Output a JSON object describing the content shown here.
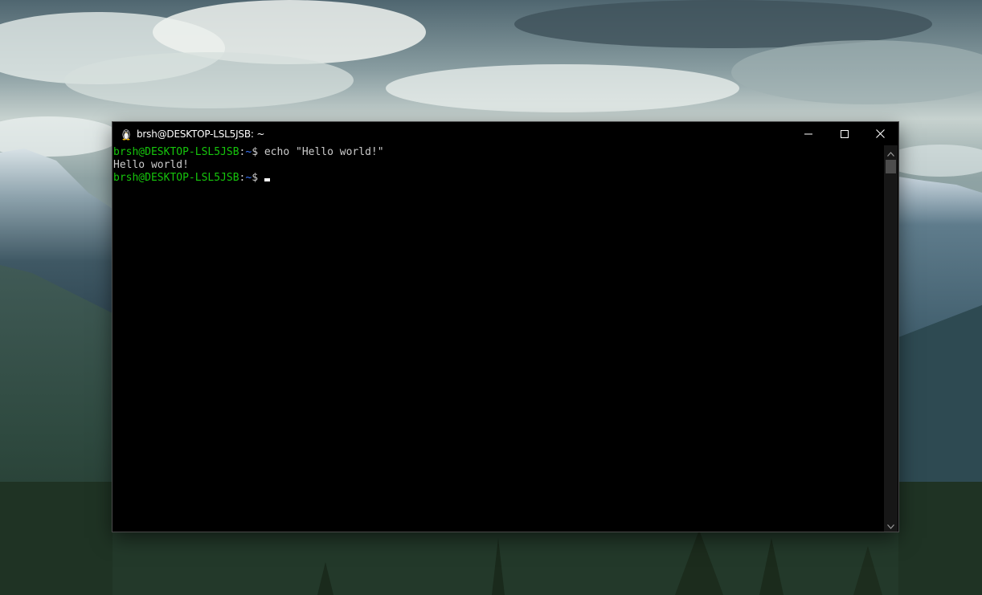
{
  "window": {
    "title": "brsh@DESKTOP-LSL5JSB: ~",
    "app_icon": "tux-penguin-icon",
    "controls": {
      "minimize_icon": "minimize-icon",
      "maximize_icon": "maximize-icon",
      "close_icon": "close-icon"
    }
  },
  "terminal": {
    "lines": [
      {
        "user_host": "brsh@DESKTOP-LSL5JSB",
        "separator": ":",
        "path": "~",
        "symbol": "$",
        "command": " echo \"Hello world!\""
      },
      {
        "output": "Hello world!"
      },
      {
        "user_host": "brsh@DESKTOP-LSL5JSB",
        "separator": ":",
        "path": "~",
        "symbol": "$",
        "command": " "
      }
    ],
    "colors": {
      "background": "#000000",
      "foreground": "#cccccc",
      "prompt_user": "#16c60c",
      "prompt_path": "#3b78ff"
    }
  },
  "scrollbar": {
    "up_icon": "scroll-up-arrow-icon",
    "down_icon": "scroll-down-arrow-icon"
  }
}
